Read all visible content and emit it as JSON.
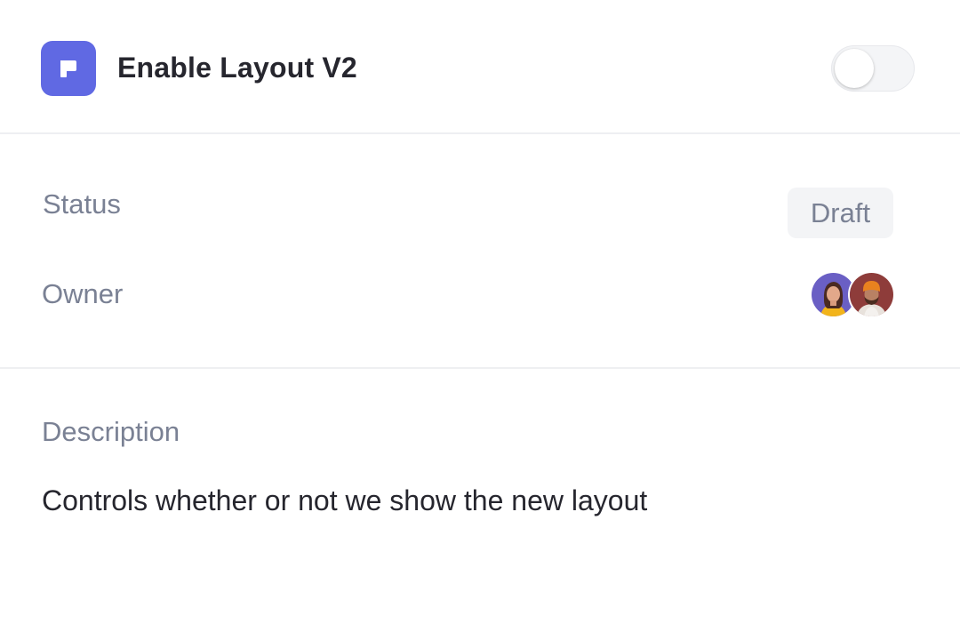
{
  "flag": {
    "icon": "flag-icon",
    "title": "Enable Layout V2",
    "enabled": false,
    "accent_color": "#6069e3"
  },
  "details": {
    "status_label": "Status",
    "status_value": "Draft",
    "owner_label": "Owner",
    "owners": [
      {
        "avatar": "avatar-woman-icon"
      },
      {
        "avatar": "avatar-man-orange-beanie-icon"
      }
    ]
  },
  "description": {
    "label": "Description",
    "text": "Controls whether or not we show the new layout"
  }
}
